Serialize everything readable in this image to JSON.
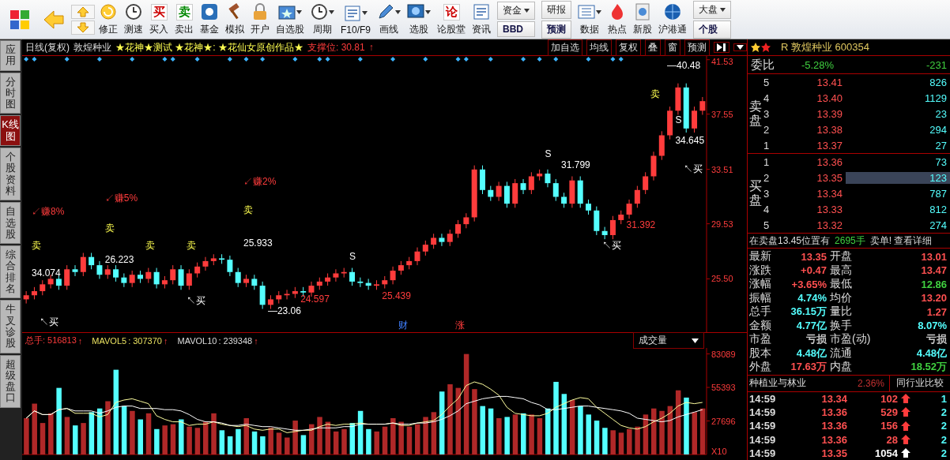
{
  "toolbar": [
    {
      "kind": "icon"
    },
    {
      "kind": "icon"
    },
    {
      "kind": "arrows"
    },
    {
      "kind": "button",
      "label": "修正"
    },
    {
      "kind": "button",
      "label": "测速"
    },
    {
      "kind": "button",
      "label": "买入",
      "glyph": "买"
    },
    {
      "kind": "button",
      "label": "卖出",
      "glyph": "卖"
    },
    {
      "kind": "button",
      "label": "基金"
    },
    {
      "kind": "button",
      "label": "模拟"
    },
    {
      "kind": "button",
      "label": "开户"
    },
    {
      "kind": "button",
      "label": "自选股",
      "dropdown": true
    },
    {
      "kind": "button",
      "label": "周期",
      "dropdown": true
    },
    {
      "kind": "button",
      "label": "F10/F9",
      "dropdown": true
    },
    {
      "kind": "button",
      "label": "画线",
      "dropdown": true
    },
    {
      "kind": "button",
      "label": "选股",
      "dropdown": true
    },
    {
      "kind": "button",
      "label": "论股堂",
      "glyph": "论"
    },
    {
      "kind": "button",
      "label": "资讯"
    },
    {
      "kind": "pair",
      "top": "资金",
      "bottom": "BBD",
      "dropdown": true
    },
    {
      "kind": "pair",
      "top": "研报",
      "bottom": "预测"
    },
    {
      "kind": "button",
      "label": "数据",
      "dropdown": true
    },
    {
      "kind": "button",
      "label": "热点"
    },
    {
      "kind": "button",
      "label": "新股"
    },
    {
      "kind": "button",
      "label": "沪港通"
    },
    {
      "kind": "pair",
      "top": "大盘",
      "bottom": "个股",
      "dropdown": true
    }
  ],
  "side_tabs": [
    {
      "label": "应用",
      "selected": false
    },
    {
      "label": "分时图",
      "selected": false
    },
    {
      "label": "K线图",
      "selected": true
    },
    {
      "label": "个股资料",
      "selected": false
    },
    {
      "label": "自选股",
      "selected": false
    },
    {
      "label": "综合排名",
      "selected": false
    },
    {
      "label": "牛叉诊股",
      "selected": false
    },
    {
      "label": "超级盘口",
      "selected": false
    }
  ],
  "chart_header": {
    "period": "日线(复权)",
    "stock": "敦煌种业",
    "formula": "★花神★测试 ★花神★: ★花仙女原创作品★",
    "support_label": "支撑位: 30.81",
    "support_arrow": "↑",
    "buttons": [
      "加自选",
      "均线",
      "复权",
      "叠",
      "窗",
      "预测"
    ]
  },
  "price_chart": {
    "chart_data": {
      "type": "candlestick",
      "ylim": [
        21.6,
        41.8
      ],
      "yticks": [
        {
          "value": 41.53,
          "label": "41.53"
        },
        {
          "value": 37.55,
          "label": "37.55"
        },
        {
          "value": 33.51,
          "label": "33.51"
        },
        {
          "value": 29.53,
          "label": "29.53"
        },
        {
          "value": 25.5,
          "label": "25.50"
        }
      ],
      "categories": [
        null,
        null,
        null,
        null,
        null,
        null,
        null,
        null,
        null,
        null,
        null,
        null,
        null,
        null,
        null,
        null,
        null,
        null,
        null,
        null,
        null,
        null,
        null,
        null,
        null,
        null,
        null,
        null,
        null,
        null,
        null,
        null,
        null,
        null,
        null,
        null,
        null,
        null,
        null,
        null,
        null,
        null,
        null,
        null,
        null,
        null,
        null,
        null,
        null,
        null,
        null,
        null,
        null,
        null,
        null,
        null,
        null,
        null,
        null,
        null,
        null,
        null,
        null,
        null,
        null,
        null,
        null,
        null,
        null,
        null,
        null,
        null,
        null,
        null,
        null,
        null,
        null,
        null,
        null,
        null,
        null,
        null,
        null,
        null
      ],
      "ohlc": [
        [
          24.0,
          24.6,
          23.7,
          24.3
        ],
        [
          24.3,
          24.9,
          24.0,
          24.6
        ],
        [
          24.6,
          25.4,
          24.3,
          25.1
        ],
        [
          25.1,
          25.8,
          24.8,
          25.5
        ],
        [
          25.5,
          25.8,
          24.7,
          25.0
        ],
        [
          25.0,
          26.5,
          24.7,
          26.2
        ],
        [
          26.2,
          26.5,
          25.7,
          26.0
        ],
        [
          26.0,
          27.4,
          25.7,
          27.1
        ],
        [
          27.1,
          27.4,
          26.2,
          26.5
        ],
        [
          26.5,
          26.8,
          25.5,
          25.8
        ],
        [
          25.8,
          26.5,
          25.5,
          26.2
        ],
        [
          26.2,
          26.5,
          25.3,
          25.6
        ],
        [
          25.6,
          25.9,
          24.9,
          25.2
        ],
        [
          25.2,
          26.1,
          24.9,
          25.8
        ],
        [
          25.8,
          26.1,
          25.2,
          25.5
        ],
        [
          25.5,
          26.3,
          25.2,
          26.0
        ],
        [
          26.0,
          26.3,
          24.8,
          25.1
        ],
        [
          25.1,
          25.7,
          24.8,
          25.4
        ],
        [
          25.4,
          26.5,
          25.1,
          26.2
        ],
        [
          26.2,
          26.5,
          24.7,
          25.0
        ],
        [
          25.0,
          26.2,
          24.7,
          25.9
        ],
        [
          25.9,
          26.7,
          25.6,
          26.4
        ],
        [
          26.4,
          27.1,
          26.1,
          26.8
        ],
        [
          26.8,
          27.3,
          26.5,
          27.0
        ],
        [
          27.0,
          27.3,
          26.6,
          26.9
        ],
        [
          26.9,
          27.2,
          25.7,
          26.0
        ],
        [
          26.0,
          26.3,
          24.9,
          25.2
        ],
        [
          25.2,
          25.8,
          24.9,
          25.5
        ],
        [
          25.5,
          25.8,
          24.7,
          25.0
        ],
        [
          25.0,
          25.3,
          23.3,
          23.6
        ],
        [
          23.6,
          24.3,
          23.3,
          24.0
        ],
        [
          24.0,
          24.6,
          23.7,
          24.3
        ],
        [
          24.3,
          24.7,
          24.0,
          24.4
        ],
        [
          24.4,
          24.9,
          24.1,
          24.6
        ],
        [
          24.6,
          24.9,
          24.2,
          24.5
        ],
        [
          24.5,
          25.3,
          24.2,
          25.0
        ],
        [
          25.0,
          25.6,
          24.7,
          25.3
        ],
        [
          25.3,
          25.9,
          25.0,
          25.6
        ],
        [
          25.6,
          26.2,
          25.3,
          25.9
        ],
        [
          25.9,
          26.3,
          25.6,
          26.0
        ],
        [
          26.0,
          26.3,
          25.0,
          25.3
        ],
        [
          25.3,
          25.6,
          24.9,
          25.2
        ],
        [
          25.2,
          25.5,
          24.7,
          25.0
        ],
        [
          25.0,
          25.4,
          24.7,
          25.1
        ],
        [
          25.1,
          25.7,
          24.8,
          25.4
        ],
        [
          25.4,
          26.4,
          25.1,
          26.1
        ],
        [
          26.1,
          26.8,
          25.8,
          26.5
        ],
        [
          26.5,
          27.1,
          26.2,
          26.8
        ],
        [
          26.8,
          27.8,
          26.5,
          27.5
        ],
        [
          27.5,
          28.3,
          27.2,
          28.0
        ],
        [
          28.0,
          28.8,
          27.7,
          28.5
        ],
        [
          28.5,
          28.8,
          27.9,
          28.2
        ],
        [
          28.2,
          29.1,
          27.9,
          28.8
        ],
        [
          28.8,
          29.8,
          28.5,
          29.5
        ],
        [
          29.5,
          30.3,
          29.2,
          30.0
        ],
        [
          30.0,
          33.8,
          29.7,
          33.5
        ],
        [
          33.5,
          33.8,
          31.7,
          32.0
        ],
        [
          32.0,
          32.3,
          31.2,
          31.5
        ],
        [
          31.5,
          32.6,
          31.2,
          32.3
        ],
        [
          32.3,
          32.6,
          30.7,
          31.0
        ],
        [
          31.0,
          32.8,
          30.7,
          32.5
        ],
        [
          32.5,
          32.8,
          31.7,
          32.0
        ],
        [
          32.0,
          33.3,
          31.7,
          33.0
        ],
        [
          33.0,
          33.5,
          32.7,
          33.2
        ],
        [
          33.2,
          33.5,
          32.2,
          32.5
        ],
        [
          32.5,
          32.8,
          31.2,
          31.5
        ],
        [
          31.5,
          31.8,
          30.7,
          31.0
        ],
        [
          31.0,
          33.0,
          30.7,
          32.7
        ],
        [
          32.7,
          33.0,
          30.7,
          31.0
        ],
        [
          31.0,
          31.3,
          30.2,
          30.5
        ],
        [
          30.5,
          30.8,
          28.7,
          29.0
        ],
        [
          29.0,
          29.3,
          28.4,
          28.7
        ],
        [
          28.7,
          30.1,
          28.4,
          29.8
        ],
        [
          29.8,
          30.5,
          29.5,
          30.2
        ],
        [
          30.2,
          31.3,
          29.9,
          31.0
        ],
        [
          31.0,
          32.3,
          30.7,
          32.0
        ],
        [
          32.0,
          33.3,
          31.7,
          33.0
        ],
        [
          33.0,
          34.8,
          32.7,
          34.5
        ],
        [
          34.5,
          36.3,
          34.2,
          36.0
        ],
        [
          36.0,
          38.1,
          35.7,
          37.8
        ],
        [
          37.8,
          39.8,
          37.5,
          39.5
        ],
        [
          39.5,
          39.8,
          36.2,
          36.5
        ],
        [
          36.5,
          38.1,
          36.2,
          37.8
        ],
        [
          37.8,
          38.8,
          37.5,
          38.5
        ]
      ]
    },
    "annotations": [
      {
        "text": "—40.48",
        "kind": "price"
      },
      {
        "text": "卖",
        "kind": "sell"
      },
      {
        "text": "S",
        "kind": "signal"
      },
      {
        "text": "34.645",
        "kind": "price"
      },
      {
        "text": "S",
        "kind": "signal"
      },
      {
        "text": "31.799",
        "kind": "price"
      },
      {
        "text": "↖买",
        "kind": "buy"
      },
      {
        "text": "↙赚2%",
        "kind": "profit"
      },
      {
        "text": "↙赚5%",
        "kind": "profit"
      },
      {
        "text": "↙赚8%",
        "kind": "profit"
      },
      {
        "text": "卖",
        "kind": "sell"
      },
      {
        "text": "卖",
        "kind": "sell"
      },
      {
        "text": "31.392",
        "kind": "low"
      },
      {
        "text": "卖",
        "kind": "sell"
      },
      {
        "text": "卖",
        "kind": "sell"
      },
      {
        "text": "卖",
        "kind": "sell"
      },
      {
        "text": "25.933",
        "kind": "price"
      },
      {
        "text": "↖买",
        "kind": "buy"
      },
      {
        "text": "26.223",
        "kind": "price"
      },
      {
        "text": "S",
        "kind": "signal"
      },
      {
        "text": "34.074",
        "kind": "price"
      },
      {
        "text": "↖买",
        "kind": "buy"
      },
      {
        "text": "24.597",
        "kind": "low"
      },
      {
        "text": "25.439",
        "kind": "low"
      },
      {
        "text": "—23.06",
        "kind": "price"
      },
      {
        "text": "↖买",
        "kind": "buy"
      },
      {
        "text": "财",
        "kind": "finance"
      },
      {
        "text": "涨",
        "kind": "profit"
      }
    ]
  },
  "volume_panel": {
    "total_label": "总手: 516813",
    "total_arrow": "↑",
    "ma5_value": ": 307370",
    "ma5_arrow": "↑",
    "ma10_value": ": 239348",
    "ma10_arrow": "↑",
    "dropdown": "成交量",
    "unit_label": "X10",
    "chart_data": {
      "type": "bar",
      "ylim": [
        0,
        88000
      ],
      "yticks": [
        27696,
        55393,
        83089
      ],
      "series": [
        {
          "colors": [
            "#b02828",
            "#b02828",
            "#b02828",
            "#b02828",
            "#54ffff",
            "#b02828",
            "#54ffff",
            "#b02828",
            "#54ffff",
            "#54ffff",
            "#b02828",
            "#54ffff",
            "#54ffff",
            "#b02828",
            "#54ffff",
            "#b02828",
            "#54ffff",
            "#b02828",
            "#b02828",
            "#54ffff",
            "#b02828",
            "#b02828",
            "#b02828",
            "#b02828",
            "#54ffff",
            "#54ffff",
            "#54ffff",
            "#b02828",
            "#54ffff",
            "#54ffff",
            "#b02828",
            "#b02828",
            "#b02828",
            "#b02828",
            "#54ffff",
            "#b02828",
            "#b02828",
            "#b02828",
            "#b02828",
            "#b02828",
            "#54ffff",
            "#54ffff",
            "#54ffff",
            "#b02828",
            "#b02828",
            "#b02828",
            "#b02828",
            "#b02828",
            "#b02828",
            "#b02828",
            "#b02828",
            "#54ffff",
            "#b02828",
            "#b02828",
            "#b02828",
            "#b02828",
            "#54ffff",
            "#54ffff",
            "#b02828",
            "#54ffff",
            "#b02828",
            "#54ffff",
            "#b02828",
            "#b02828",
            "#54ffff",
            "#54ffff",
            "#54ffff",
            "#b02828",
            "#54ffff",
            "#54ffff",
            "#54ffff",
            "#54ffff",
            "#b02828",
            "#b02828",
            "#b02828",
            "#b02828",
            "#b02828",
            "#b02828",
            "#b02828",
            "#b02828",
            "#b02828",
            "#54ffff",
            "#b02828",
            "#b02828"
          ],
          "values": [
            30000,
            42000,
            26000,
            34000,
            55000,
            31000,
            24000,
            26000,
            35000,
            38000,
            44000,
            70000,
            40000,
            36000,
            29000,
            34000,
            21000,
            24000,
            25000,
            29000,
            23000,
            22000,
            27000,
            34000,
            20000,
            15000,
            21000,
            30000,
            19000,
            15000,
            22000,
            18000,
            14000,
            28000,
            16000,
            25000,
            31000,
            27000,
            19000,
            21000,
            26000,
            36000,
            21000,
            19000,
            23000,
            30000,
            27000,
            23000,
            25000,
            31000,
            35000,
            52000,
            58000,
            55000,
            83000,
            54000,
            40000,
            38000,
            30000,
            31000,
            33000,
            34000,
            33000,
            30000,
            38000,
            60000,
            50000,
            45000,
            40000,
            33000,
            28000,
            22000,
            20000,
            18000,
            21000,
            23000,
            33000,
            38000,
            36000,
            40000,
            53000,
            47000,
            35000,
            38000
          ]
        },
        {
          "name": "MAVOL5",
          "type": "line",
          "color": "#ffffa0",
          "values": [
            30000,
            36000,
            33000,
            33000,
            37000,
            38000,
            34000,
            34000,
            34000,
            31000,
            33000,
            43000,
            45000,
            46000,
            44000,
            42000,
            32000,
            29000,
            27000,
            27000,
            24000,
            25000,
            25000,
            27000,
            25000,
            24000,
            23000,
            24000,
            21000,
            20000,
            21000,
            21000,
            18000,
            19000,
            20000,
            20000,
            23000,
            25000,
            24000,
            25000,
            25000,
            26000,
            25000,
            25000,
            25000,
            26000,
            24000,
            24000,
            26000,
            27000,
            28000,
            33000,
            40000,
            46000,
            57000,
            60000,
            58000,
            54000,
            49000,
            39000,
            34000,
            33000,
            32000,
            32000,
            34000,
            39000,
            42000,
            45000,
            47000,
            46000,
            39000,
            34000,
            29000,
            24000,
            22000,
            21000,
            23000,
            27000,
            30000,
            34000,
            40000,
            43000,
            42000,
            43000
          ]
        },
        {
          "name": "MAVOL10",
          "type": "line",
          "color": "#ffffff",
          "values": [
            30000,
            36000,
            33000,
            33000,
            37000,
            38000,
            36000,
            36000,
            36000,
            34000,
            36000,
            39000,
            40000,
            40000,
            38000,
            38000,
            38000,
            37000,
            37000,
            36000,
            33000,
            29000,
            27000,
            27000,
            26000,
            24000,
            24000,
            25000,
            24000,
            23000,
            23000,
            22000,
            21000,
            20000,
            20000,
            21000,
            22000,
            22000,
            22000,
            23000,
            23000,
            25000,
            25000,
            25000,
            25000,
            26000,
            25000,
            25000,
            26000,
            26000,
            27000,
            29000,
            32000,
            36000,
            42000,
            44000,
            46000,
            47000,
            48000,
            48000,
            47000,
            46000,
            43000,
            41000,
            37000,
            37000,
            38000,
            39000,
            40000,
            40000,
            39000,
            38000,
            37000,
            36000,
            34000,
            30000,
            29000,
            28000,
            27000,
            28000,
            31000,
            33000,
            35000,
            37000
          ]
        }
      ]
    }
  },
  "quote": {
    "title": "R 敦煌种业 600354",
    "ratio_label": "委比",
    "ratio_pct": "-5.28%",
    "ratio_diff": "-231",
    "sell_label": "卖盘",
    "buy_label": "买盘",
    "sell": [
      {
        "rank": "5",
        "price": "13.41",
        "volume": "826",
        "selected": false
      },
      {
        "rank": "4",
        "price": "13.40",
        "volume": "1129",
        "selected": false
      },
      {
        "rank": "3",
        "price": "13.39",
        "volume": "23",
        "selected": false
      },
      {
        "rank": "2",
        "price": "13.38",
        "volume": "294",
        "selected": false
      },
      {
        "rank": "1",
        "price": "13.37",
        "volume": "27",
        "selected": false
      }
    ],
    "buy": [
      {
        "rank": "1",
        "price": "13.36",
        "volume": "73",
        "selected": false
      },
      {
        "rank": "2",
        "price": "13.35",
        "volume": "123",
        "selected": true
      },
      {
        "rank": "3",
        "price": "13.34",
        "volume": "787",
        "selected": false
      },
      {
        "rank": "4",
        "price": "13.33",
        "volume": "812",
        "selected": false
      },
      {
        "rank": "5",
        "price": "13.32",
        "volume": "274",
        "selected": false
      }
    ],
    "notice": {
      "prefix": "在卖盘13.45位置有",
      "volume": "2695手",
      "suffix": "卖单! 查看详细"
    },
    "stats": [
      [
        {
          "label": "最新",
          "value": "13.35",
          "color": "#ff5050"
        },
        {
          "label": "开盘",
          "value": "13.01",
          "color": "#ff5050"
        }
      ],
      [
        {
          "label": "涨跌",
          "value": "+0.47",
          "color": "#ff5050"
        },
        {
          "label": "最高",
          "value": "13.47",
          "color": "#ff5050"
        }
      ],
      [
        {
          "label": "涨幅",
          "value": "+3.65%",
          "color": "#ff5050"
        },
        {
          "label": "最低",
          "value": "12.86",
          "color": "#40d040"
        }
      ],
      [
        {
          "label": "振幅",
          "value": "4.74%",
          "color": "#54ffff"
        },
        {
          "label": "均价",
          "value": "13.20",
          "color": "#ff5050"
        }
      ],
      [
        {
          "label": "总手",
          "value": "36.15万",
          "color": "#54ffff"
        },
        {
          "label": "量比",
          "value": "1.27",
          "color": "#ff5050"
        }
      ],
      [
        {
          "label": "金额",
          "value": "4.77亿",
          "color": "#54ffff"
        },
        {
          "label": "换手",
          "value": "8.07%",
          "color": "#54ffff"
        }
      ],
      [
        {
          "label": "市盈",
          "value": "亏损",
          "color": "#c8c8c8"
        },
        {
          "label": "市盈(动)",
          "value": "亏损",
          "color": "#c8c8c8"
        }
      ],
      [
        {
          "label": "股本",
          "value": "4.48亿",
          "color": "#54ffff"
        },
        {
          "label": "流通",
          "value": "4.48亿",
          "color": "#54ffff"
        }
      ],
      [
        {
          "label": "外盘",
          "value": "17.63万",
          "color": "#ff5050"
        },
        {
          "label": "内盘",
          "value": "18.52万",
          "color": "#40d040"
        }
      ]
    ],
    "industry": {
      "name": "种植业与林业",
      "change": "2.36%",
      "compare": "同行业比较"
    },
    "trades": [
      {
        "time": "14:59",
        "price": "13.34",
        "volume": "102",
        "count": "1",
        "large": false
      },
      {
        "time": "14:59",
        "price": "13.36",
        "volume": "529",
        "count": "2",
        "large": false
      },
      {
        "time": "14:59",
        "price": "13.36",
        "volume": "156",
        "count": "2",
        "large": false
      },
      {
        "time": "14:59",
        "price": "13.36",
        "volume": "28",
        "count": "2",
        "large": false
      },
      {
        "time": "14:59",
        "price": "13.35",
        "volume": "1054",
        "count": "2",
        "large": true
      }
    ]
  }
}
